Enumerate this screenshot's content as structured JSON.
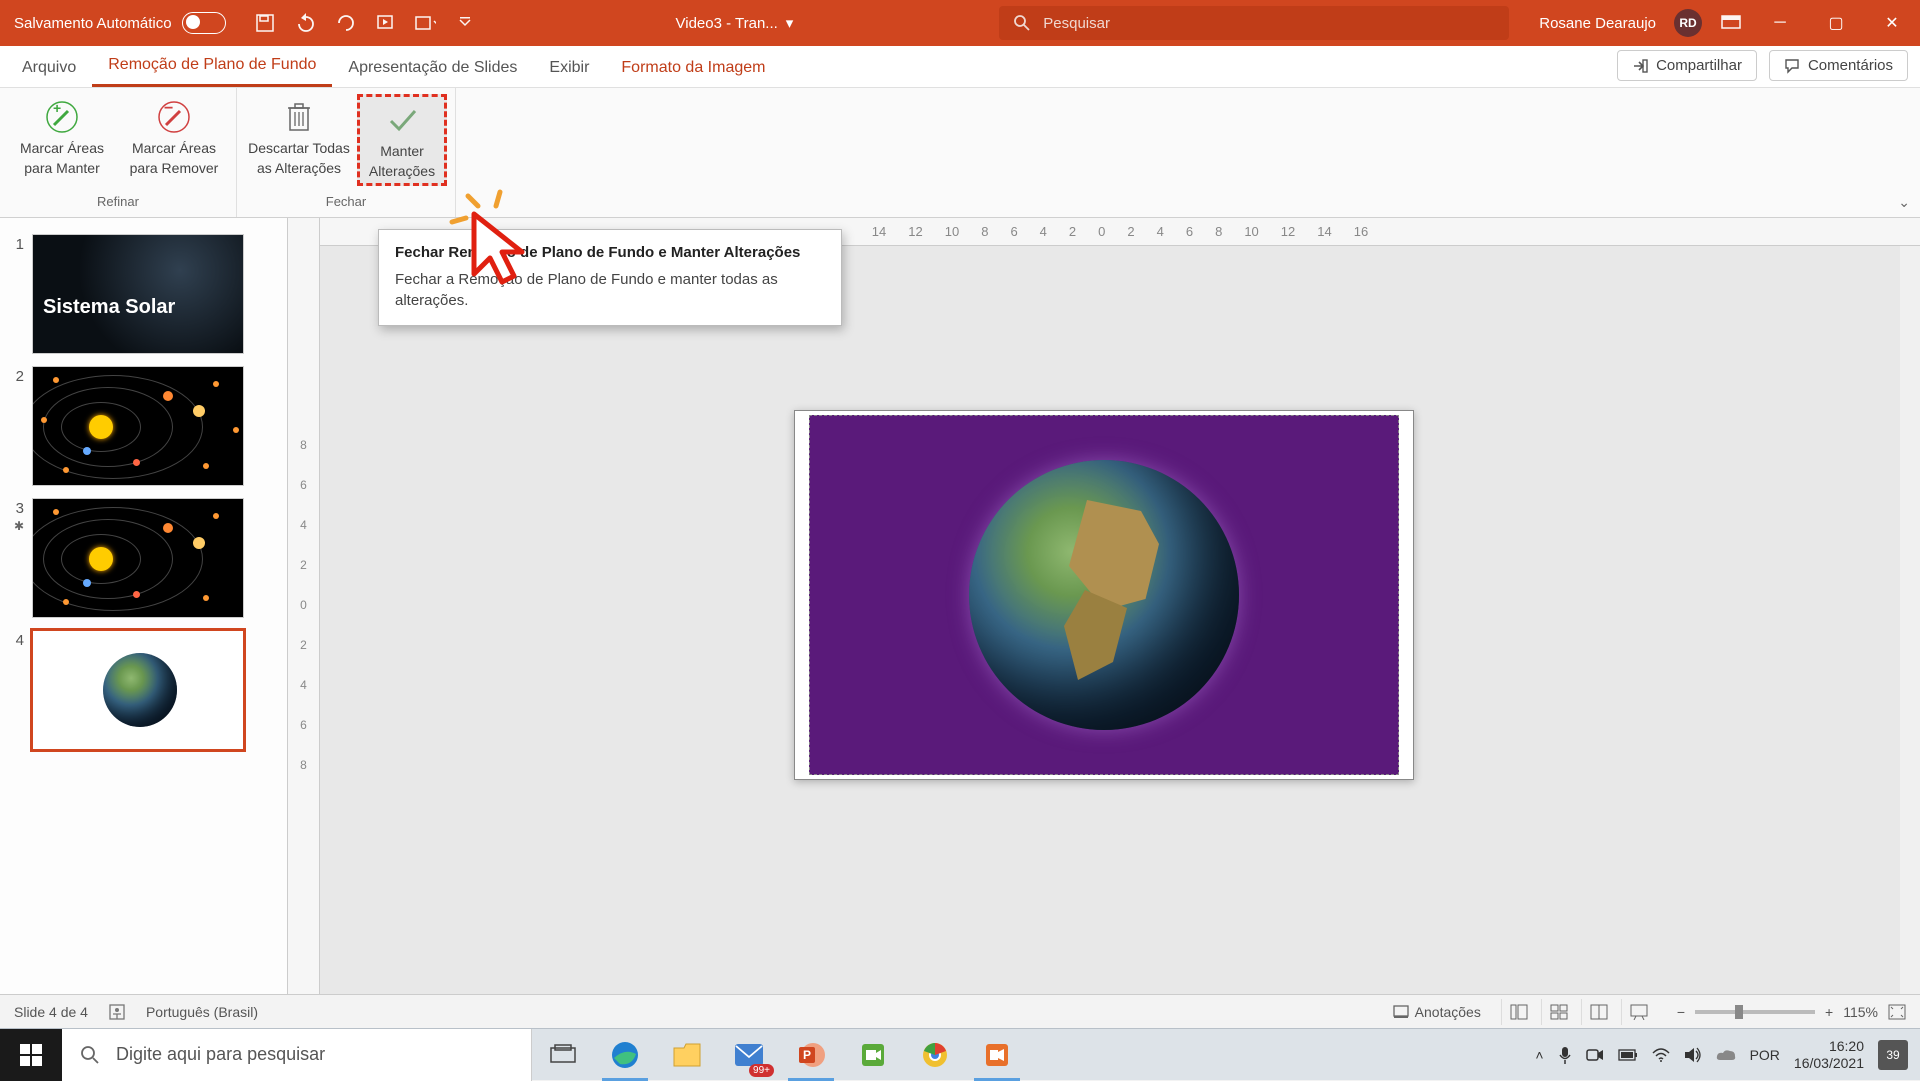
{
  "titleBar": {
    "autosave": "Salvamento Automático",
    "docName": "Video3 - Tran...",
    "searchPlaceholder": "Pesquisar",
    "userName": "Rosane Dearaujo",
    "userInitials": "RD"
  },
  "tabs": {
    "arquivo": "Arquivo",
    "remocao": "Remoção de Plano de Fundo",
    "apresentacao": "Apresentação de Slides",
    "exibir": "Exibir",
    "formato": "Formato da Imagem",
    "compartilhar": "Compartilhar",
    "comentarios": "Comentários"
  },
  "ribbon": {
    "marcarManter1": "Marcar Áreas",
    "marcarManter2": "para Manter",
    "marcarRemover1": "Marcar Áreas",
    "marcarRemover2": "para Remover",
    "refinarGroup": "Refinar",
    "descartar1": "Descartar Todas",
    "descartar2": "as Alterações",
    "manter1": "Manter",
    "manter2": "Alterações",
    "fecharGroup": "Fechar"
  },
  "tooltip": {
    "title": "Fechar Remoção de Plano de Fundo e Manter Alterações",
    "body": "Fechar a Remoção de Plano de Fundo e manter todas as alterações."
  },
  "rulerH": [
    "14",
    "12",
    "10",
    "8",
    "6",
    "4",
    "2",
    "0",
    "2",
    "4",
    "6",
    "8",
    "10",
    "12",
    "14",
    "16"
  ],
  "rulerV": [
    "8",
    "6",
    "4",
    "2",
    "0",
    "2",
    "4",
    "6",
    "8"
  ],
  "thumbs": {
    "slide1Title": "Sistema Solar",
    "n1": "1",
    "n2": "2",
    "n3": "3",
    "n4": "4"
  },
  "statusBar": {
    "slideInfo": "Slide 4 de 4",
    "language": "Português (Brasil)",
    "notes": "Anotações",
    "zoom": "115%"
  },
  "taskbar": {
    "searchPlaceholder": "Digite aqui para pesquisar",
    "badgeCount": "99+",
    "lang": "POR",
    "time": "16:20",
    "date": "16/03/2021",
    "notif": "39"
  }
}
